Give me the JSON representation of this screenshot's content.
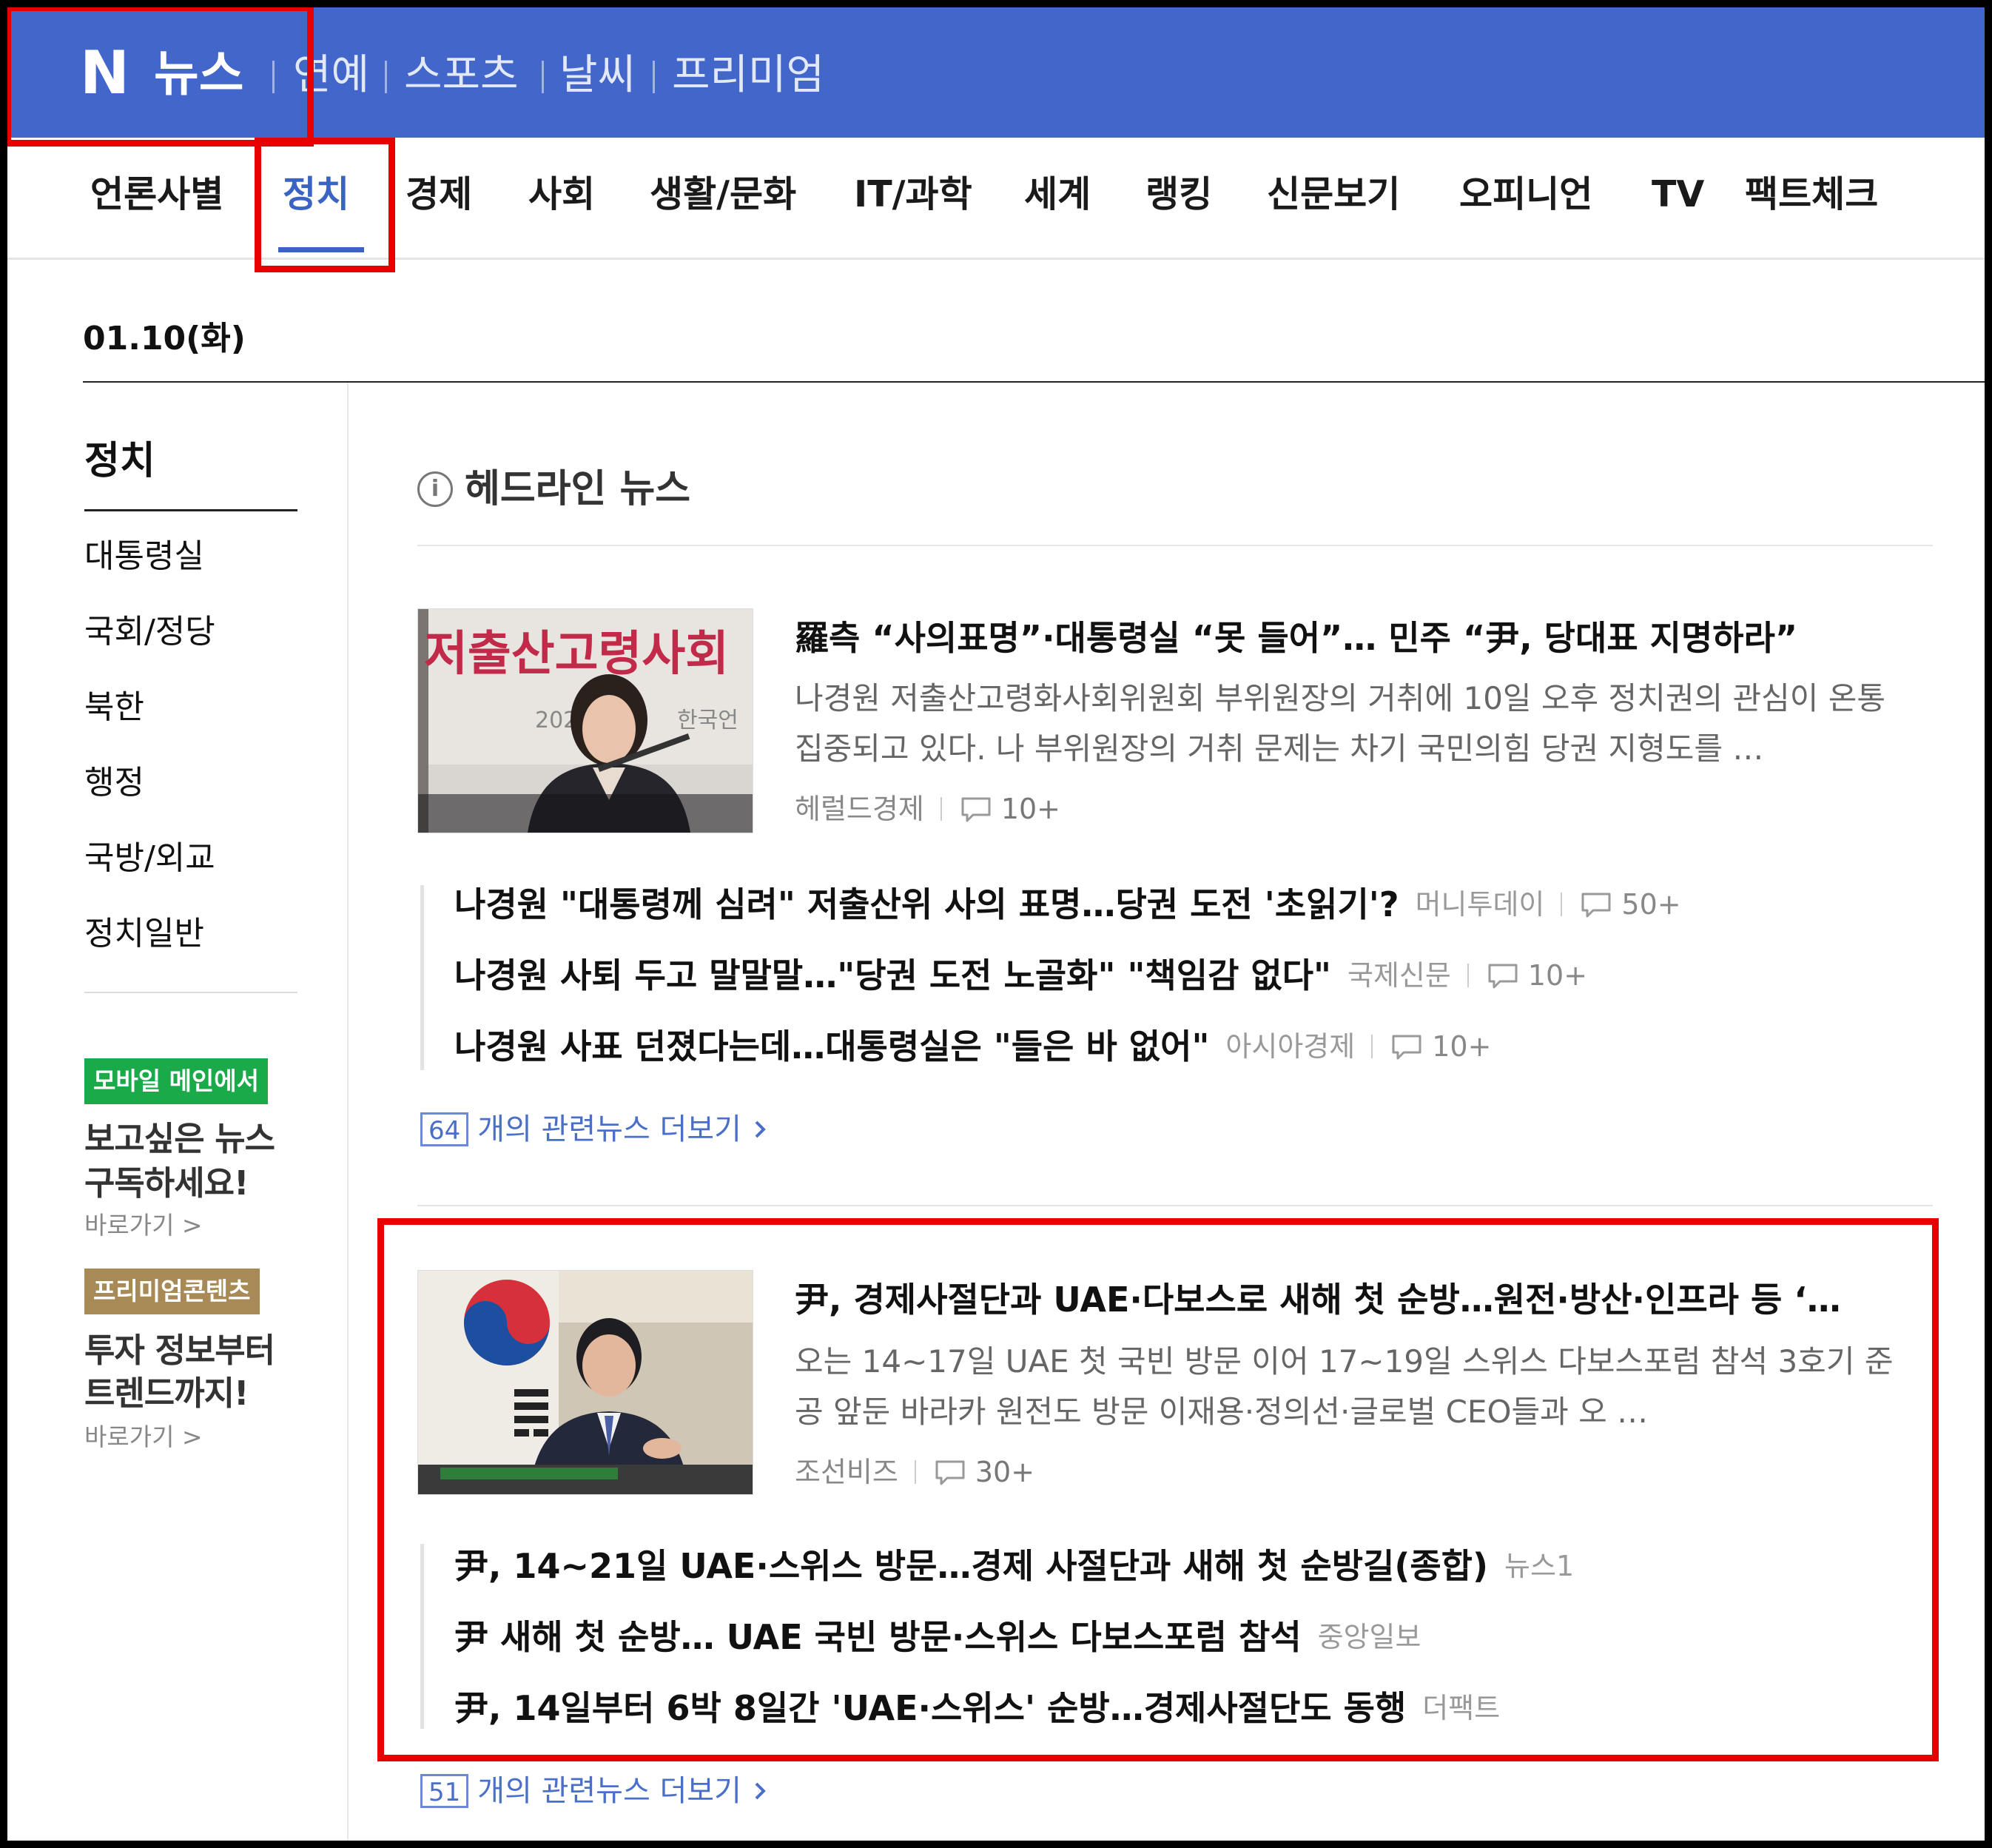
{
  "topbar": {
    "logo": "N",
    "title": "뉴스",
    "nav": [
      "연예",
      "스포츠",
      "날씨",
      "프리미엄"
    ]
  },
  "categories": [
    "언론사별",
    "정치",
    "경제",
    "사회",
    "생활/문화",
    "IT/과학",
    "세계",
    "랭킹",
    "신문보기",
    "오피니언",
    "TV",
    "팩트체크"
  ],
  "active_category": "정치",
  "date": "01.10(화)",
  "sidebar": {
    "title": "정치",
    "items": [
      "대통령실",
      "국회/정당",
      "북한",
      "행정",
      "국방/외교",
      "정치일반"
    ],
    "promos": [
      {
        "badge": "모바일 메인에서",
        "line1": "보고싶은 뉴스",
        "line2": "구독하세요!",
        "link": "바로가기 >"
      },
      {
        "badge": "프리미엄콘텐츠",
        "line1": "투자 정보부터",
        "line2": "트렌드까지!",
        "link": "바로가기 >"
      }
    ]
  },
  "main": {
    "section_title": "헤드라인 뉴스",
    "clusters": [
      {
        "thumb_text": "저출산고령사회",
        "thumb_sub": "2023",
        "thumb_sub2": "한국언",
        "title": "羅측 “사의표명”·대통령실 “못 들어”… 민주 “尹, 당대표 지명하라”",
        "summary": "나경원 저출산고령화사회위원회 부위원장의 거취에 10일 오후 정치권의 관심이 온통 집중되고 있다. 나 부위원장의 거취 문제는 차기 국민의힘 당권 지형도를 …",
        "source": "헤럴드경제",
        "comments": "10+",
        "related": [
          {
            "title": "나경원 \"대통령께 심려\" 저출산위 사의 표명…당권 도전 '초읽기'?",
            "source": "머니투데이",
            "comments": "50+"
          },
          {
            "title": "나경원 사퇴 두고 말말말…\"당권 도전 노골화\" \"책임감 없다\"",
            "source": "국제신문",
            "comments": "10+"
          },
          {
            "title": "나경원 사표 던졌다는데…대통령실은 \"들은 바 없어\"",
            "source": "아시아경제",
            "comments": "10+"
          }
        ],
        "more_count": "64",
        "more_label": "개의 관련뉴스 더보기"
      },
      {
        "title": "尹, 경제사절단과 UAE·다보스로 새해 첫 순방…원전·방산·인프라 등 ‘…",
        "summary": "오는 14~17일 UAE 첫 국빈 방문 이어 17~19일 스위스 다보스포럼 참석 3호기 준공 앞둔 바라카 원전도 방문 이재용·정의선·글로벌 CEO들과 오 …",
        "source": "조선비즈",
        "comments": "30+",
        "related": [
          {
            "title": "尹, 14~21일 UAE·스위스 방문…경제 사절단과 새해 첫 순방길(종합)",
            "source": "뉴스1"
          },
          {
            "title": "尹 새해 첫 순방… UAE 국빈 방문·스위스 다보스포럼 참석",
            "source": "중앙일보"
          },
          {
            "title": "尹, 14일부터 6박 8일간 'UAE·스위스' 순방…경제사절단도 동행",
            "source": "더팩트"
          }
        ],
        "more_count": "51",
        "more_label": "개의 관련뉴스 더보기"
      }
    ]
  },
  "colors": {
    "brand_blue": "#4266c9",
    "active_blue": "#3a63c4",
    "highlight_red": "#e60000",
    "promo_green": "#1aaa4a",
    "promo_gold": "#a88a56"
  }
}
